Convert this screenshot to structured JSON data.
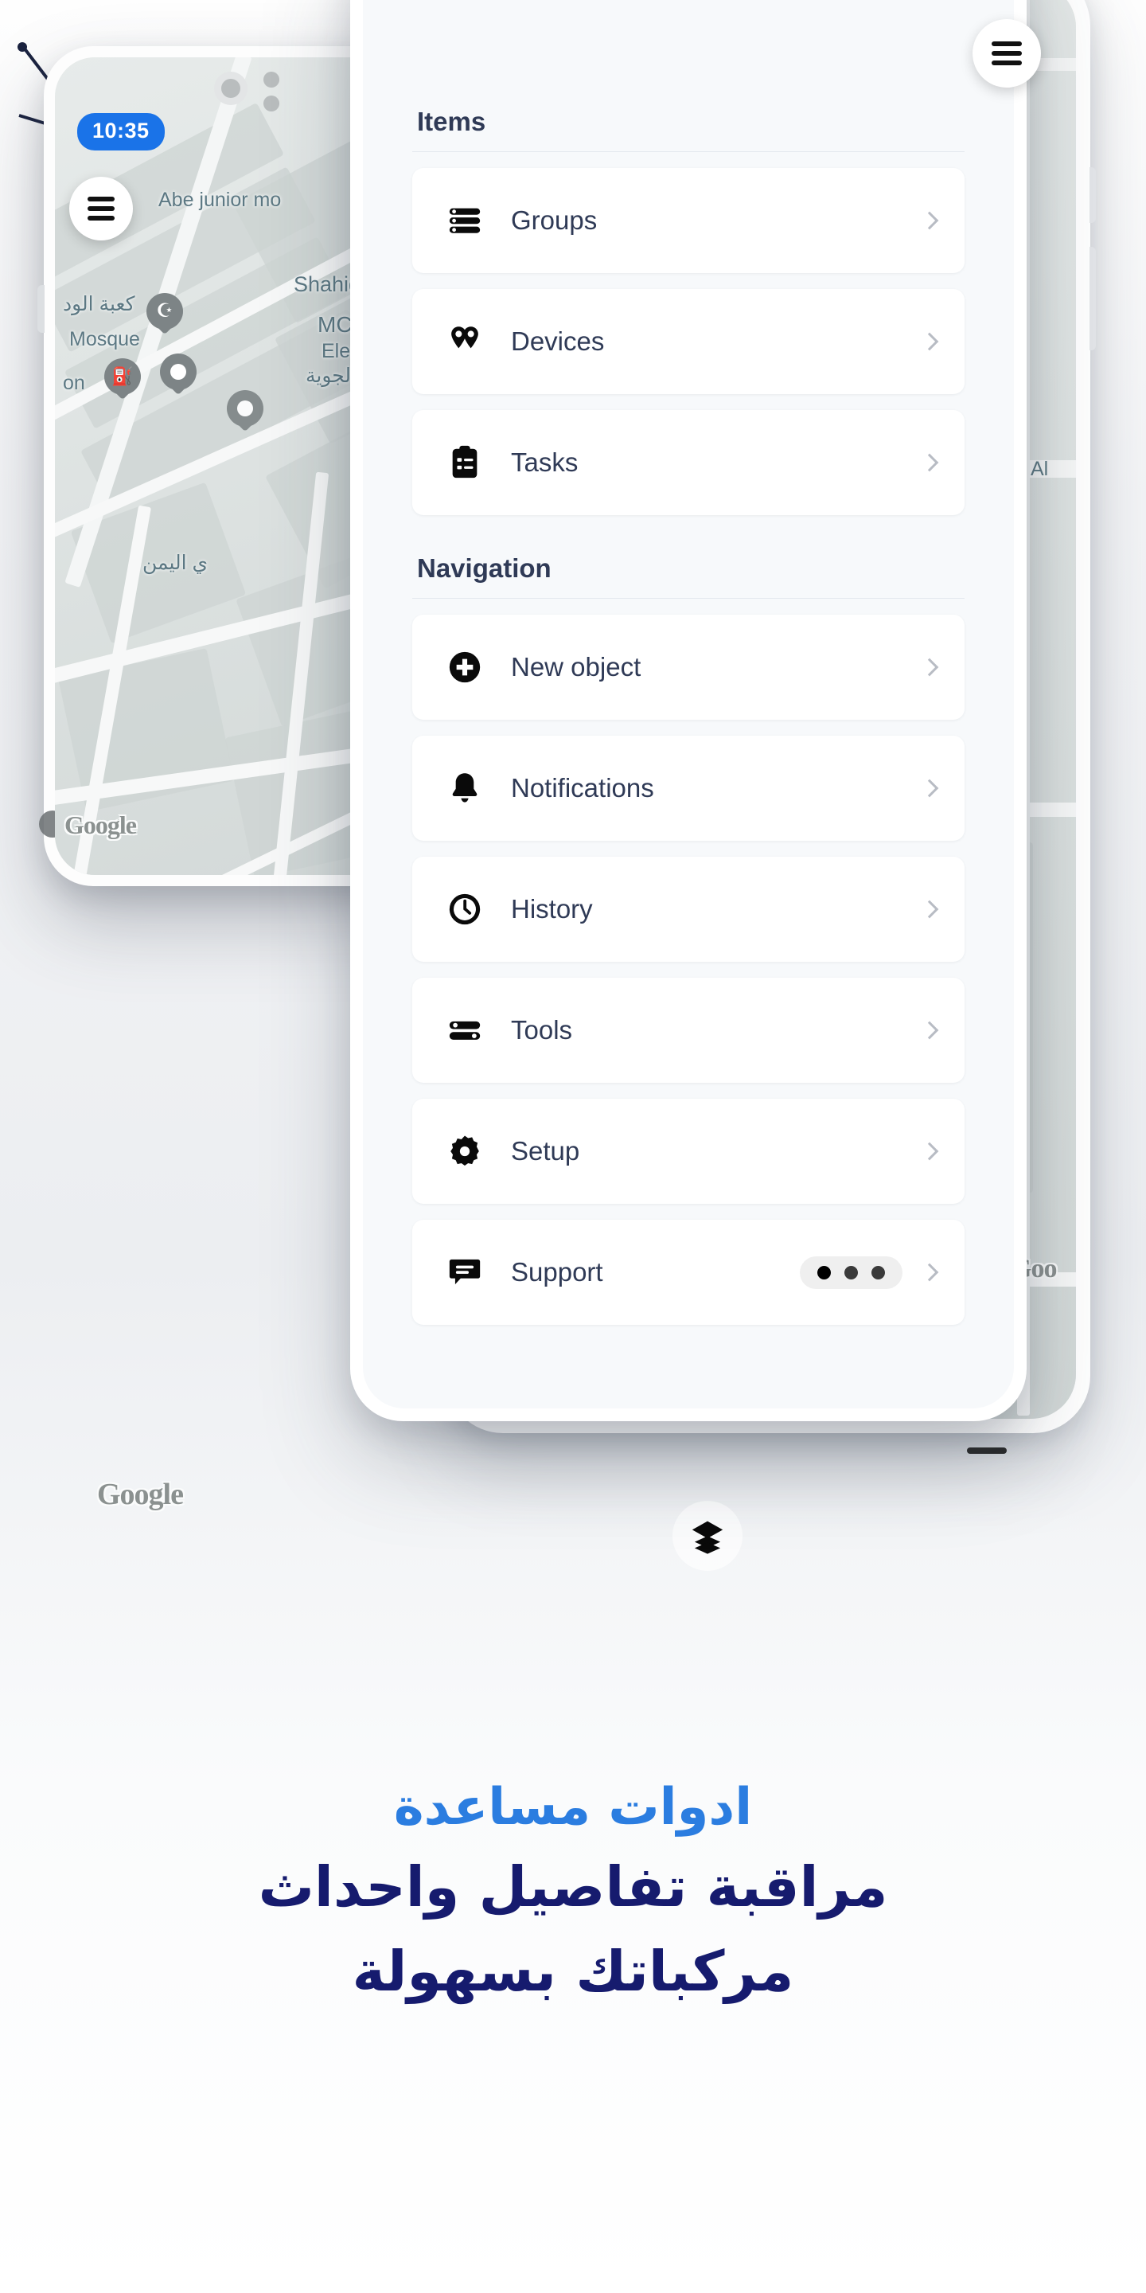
{
  "left_phone": {
    "status_time": "10:35",
    "menu_fab_icon": "hamburger-icon",
    "map_attribution": "Google",
    "map_labels": [
      {
        "text": "Abe junior mo",
        "lang": "en"
      },
      {
        "text": "كعبة الود",
        "lang": "ar"
      },
      {
        "text": "Mosque",
        "lang": "en"
      },
      {
        "text": "Shahid I",
        "lang": "en"
      },
      {
        "text": "MCP",
        "lang": "en"
      },
      {
        "text": "Electroni",
        "lang": "en"
      },
      {
        "text": "نواء الجوية",
        "lang": "ar"
      },
      {
        "text": "on",
        "lang": "en"
      },
      {
        "text": "ي اليمن",
        "lang": "ar"
      }
    ],
    "layers_button_icon": "layers-icon"
  },
  "right_phone": {
    "menu_fab_icon": "hamburger-icon",
    "map_attribution": "Goo",
    "map_labels": [
      {
        "text": "Al",
        "lang": "en"
      }
    ]
  },
  "menu": {
    "sections": [
      {
        "title": "Items",
        "items": [
          {
            "label": "Groups",
            "icon": "list-rows-icon",
            "chevron": "chevron-right-icon"
          },
          {
            "label": "Devices",
            "icon": "map-pins-icon",
            "chevron": "chevron-right-icon"
          },
          {
            "label": "Tasks",
            "icon": "clipboard-check-icon",
            "chevron": "chevron-right-icon"
          }
        ]
      },
      {
        "title": "Navigation",
        "items": [
          {
            "label": "New object",
            "icon": "plus-circle-icon",
            "chevron": "chevron-right-icon"
          },
          {
            "label": "Notifications",
            "icon": "bell-icon",
            "chevron": "chevron-right-icon"
          },
          {
            "label": "History",
            "icon": "clock-icon",
            "chevron": "chevron-right-icon"
          },
          {
            "label": "Tools",
            "icon": "sliders-icon",
            "chevron": "chevron-right-icon"
          },
          {
            "label": "Setup",
            "icon": "gear-icon",
            "chevron": "chevron-right-icon"
          },
          {
            "label": "Support",
            "icon": "chat-bubble-icon",
            "chevron": "chevron-right-icon",
            "badge": "three-dots-pill"
          }
        ]
      }
    ]
  },
  "caption": {
    "line1": "ادوات مساعدة",
    "line2_a": "مراقبة تفاصيل واحداث",
    "line2_b": "مركباتك بسهولة"
  },
  "colors": {
    "accent_blue": "#1a73e8",
    "caption_light": "#2b7de0",
    "caption_dark": "#161b6e",
    "text_navy": "#2f3a56",
    "card_bg": "#ffffff",
    "sheet_bg": "#f7f9fb"
  }
}
